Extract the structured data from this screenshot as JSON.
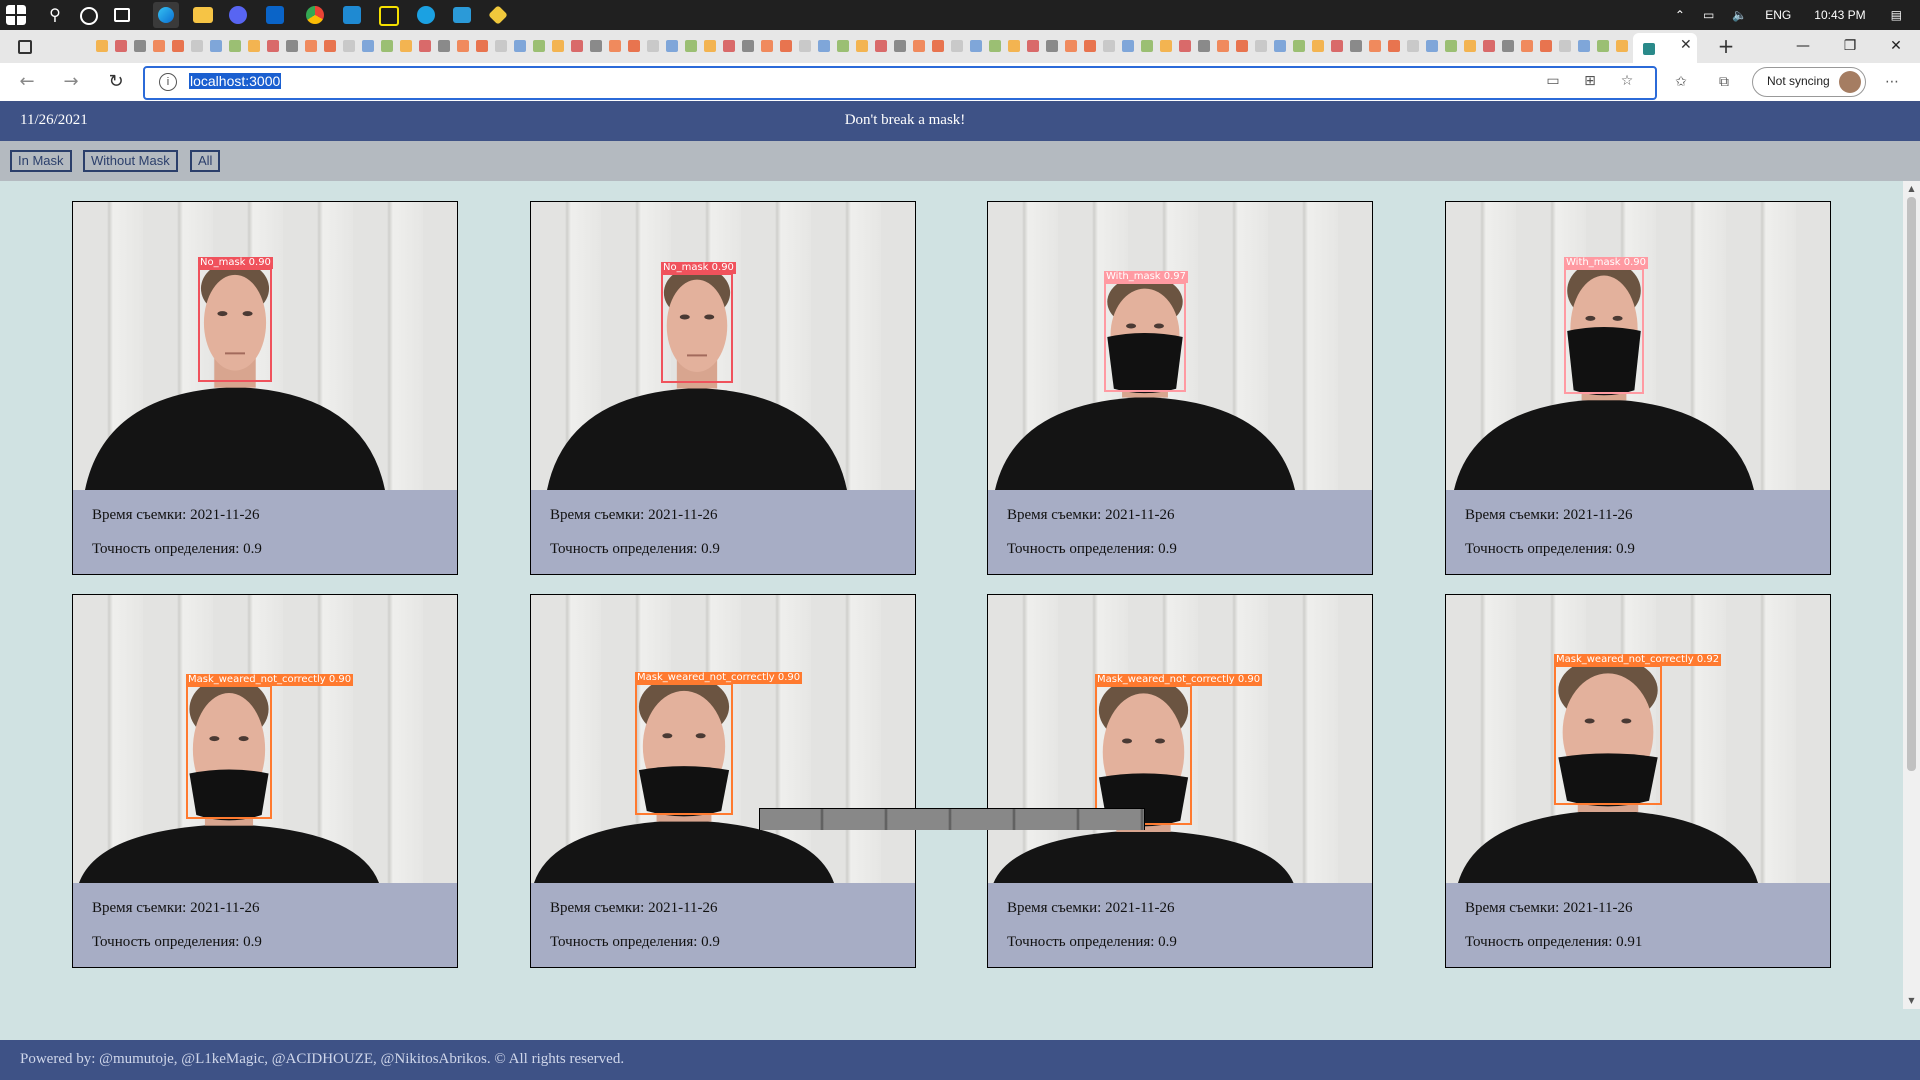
{
  "os": {
    "taskbar": {
      "language": "ENG",
      "time": "10:43 PM"
    }
  },
  "browser": {
    "url": "localhost:3000",
    "sync_label": "Not syncing"
  },
  "app": {
    "date": "11/26/2021",
    "title": "Don't break a mask!",
    "filters": [
      "In Mask",
      "Without Mask",
      "All"
    ],
    "cards": [
      {
        "label": "No_mask 0.90",
        "color": "#f0525c",
        "time": "Время съемки: 2021-11-26",
        "accuracy": "Точность определения: 0.9",
        "mask": "none"
      },
      {
        "label": "No_mask 0.90",
        "color": "#f0525c",
        "time": "Время съемки: 2021-11-26",
        "accuracy": "Точность определения: 0.9",
        "mask": "none"
      },
      {
        "label": "With_mask 0.97",
        "color": "#ff9aa2",
        "time": "Время съемки: 2021-11-26",
        "accuracy": "Точность определения: 0.9",
        "mask": "full"
      },
      {
        "label": "With_mask 0.90",
        "color": "#ff9aa2",
        "time": "Время съемки: 2021-11-26",
        "accuracy": "Точность определения: 0.9",
        "mask": "full"
      },
      {
        "label": "Mask_weared_not_correctly 0.90",
        "color": "#ff7a2f",
        "time": "Время съемки: 2021-11-26",
        "accuracy": "Точность определения: 0.9",
        "mask": "low"
      },
      {
        "label": "Mask_weared_not_correctly 0.90",
        "color": "#ff7a2f",
        "time": "Время съемки: 2021-11-26",
        "accuracy": "Точность определения: 0.9",
        "mask": "low"
      },
      {
        "label": "Mask_weared_not_correctly 0.90",
        "color": "#ff7a2f",
        "time": "Время съемки: 2021-11-26",
        "accuracy": "Точность определения: 0.9",
        "mask": "low"
      },
      {
        "label": "Mask_weared_not_correctly 0.92",
        "color": "#ff7a2f",
        "time": "Время съемки: 2021-11-26",
        "accuracy": "Точность определения: 0.91",
        "mask": "low"
      }
    ],
    "footer": "Powered by: @mumutoje, @L1keMagic, @ACIDHOUZE, @NikitosAbrikos. © All rights reserved."
  }
}
